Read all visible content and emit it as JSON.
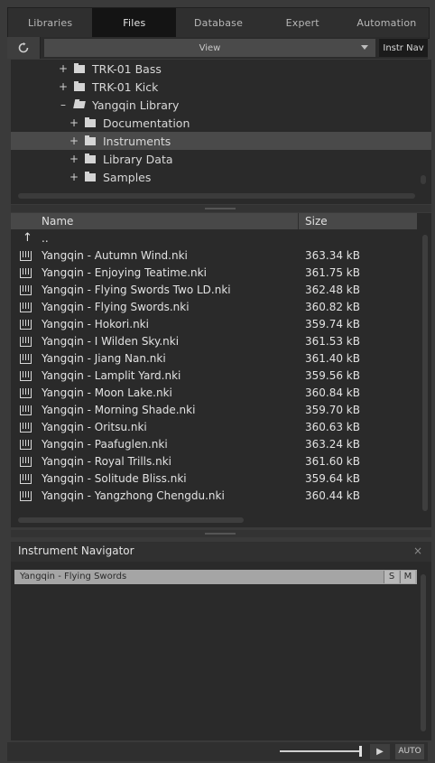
{
  "tabs": [
    {
      "label": "Libraries"
    },
    {
      "label": "Files"
    },
    {
      "label": "Database"
    },
    {
      "label": "Expert"
    },
    {
      "label": "Automation"
    }
  ],
  "viewbar": {
    "refresh_icon": "refresh-icon",
    "view_label": "View",
    "instr_nav_label": "Instr Nav"
  },
  "tree": {
    "items": [
      {
        "expander": "+",
        "label": "TRK-01 Bass"
      },
      {
        "expander": "+",
        "label": "TRK-01 Kick"
      },
      {
        "expander": "–",
        "label": "Yangqin Library"
      },
      {
        "expander": "+",
        "label": "Documentation"
      },
      {
        "expander": "+",
        "label": "Instruments"
      },
      {
        "expander": "+",
        "label": "Library Data"
      },
      {
        "expander": "+",
        "label": "Samples"
      }
    ]
  },
  "list": {
    "headers": {
      "name": "Name",
      "size": "Size"
    },
    "up_arrow": "↑",
    "parent_label": "..",
    "files": [
      {
        "name": "Yangqin - Autumn Wind.nki",
        "size": "363.34 kB"
      },
      {
        "name": "Yangqin - Enjoying Teatime.nki",
        "size": "361.75 kB"
      },
      {
        "name": "Yangqin - Flying Swords Two LD.nki",
        "size": "362.48 kB"
      },
      {
        "name": "Yangqin - Flying Swords.nki",
        "size": "360.82 kB"
      },
      {
        "name": "Yangqin - Hokori.nki",
        "size": "359.74 kB"
      },
      {
        "name": "Yangqin - I Wilden Sky.nki",
        "size": "361.53 kB"
      },
      {
        "name": "Yangqin - Jiang Nan.nki",
        "size": "361.40 kB"
      },
      {
        "name": "Yangqin - Lamplit Yard.nki",
        "size": "359.56 kB"
      },
      {
        "name": "Yangqin - Moon Lake.nki",
        "size": "360.84 kB"
      },
      {
        "name": "Yangqin - Morning Shade.nki",
        "size": "359.70 kB"
      },
      {
        "name": "Yangqin - Oritsu.nki",
        "size": "360.63 kB"
      },
      {
        "name": "Yangqin - Paafuglen.nki",
        "size": "363.24 kB"
      },
      {
        "name": "Yangqin - Royal Trills.nki",
        "size": "361.60 kB"
      },
      {
        "name": "Yangqin - Solitude Bliss.nki",
        "size": "359.64 kB"
      },
      {
        "name": "Yangqin - Yangzhong Chengdu.nki",
        "size": "360.44 kB"
      }
    ]
  },
  "navigator": {
    "title": "Instrument Navigator",
    "close": "×",
    "item_label": "Yangqin - Flying Swords",
    "solo": "S",
    "mute": "M"
  },
  "bottombar": {
    "play": "▶",
    "auto": "AUTO"
  }
}
